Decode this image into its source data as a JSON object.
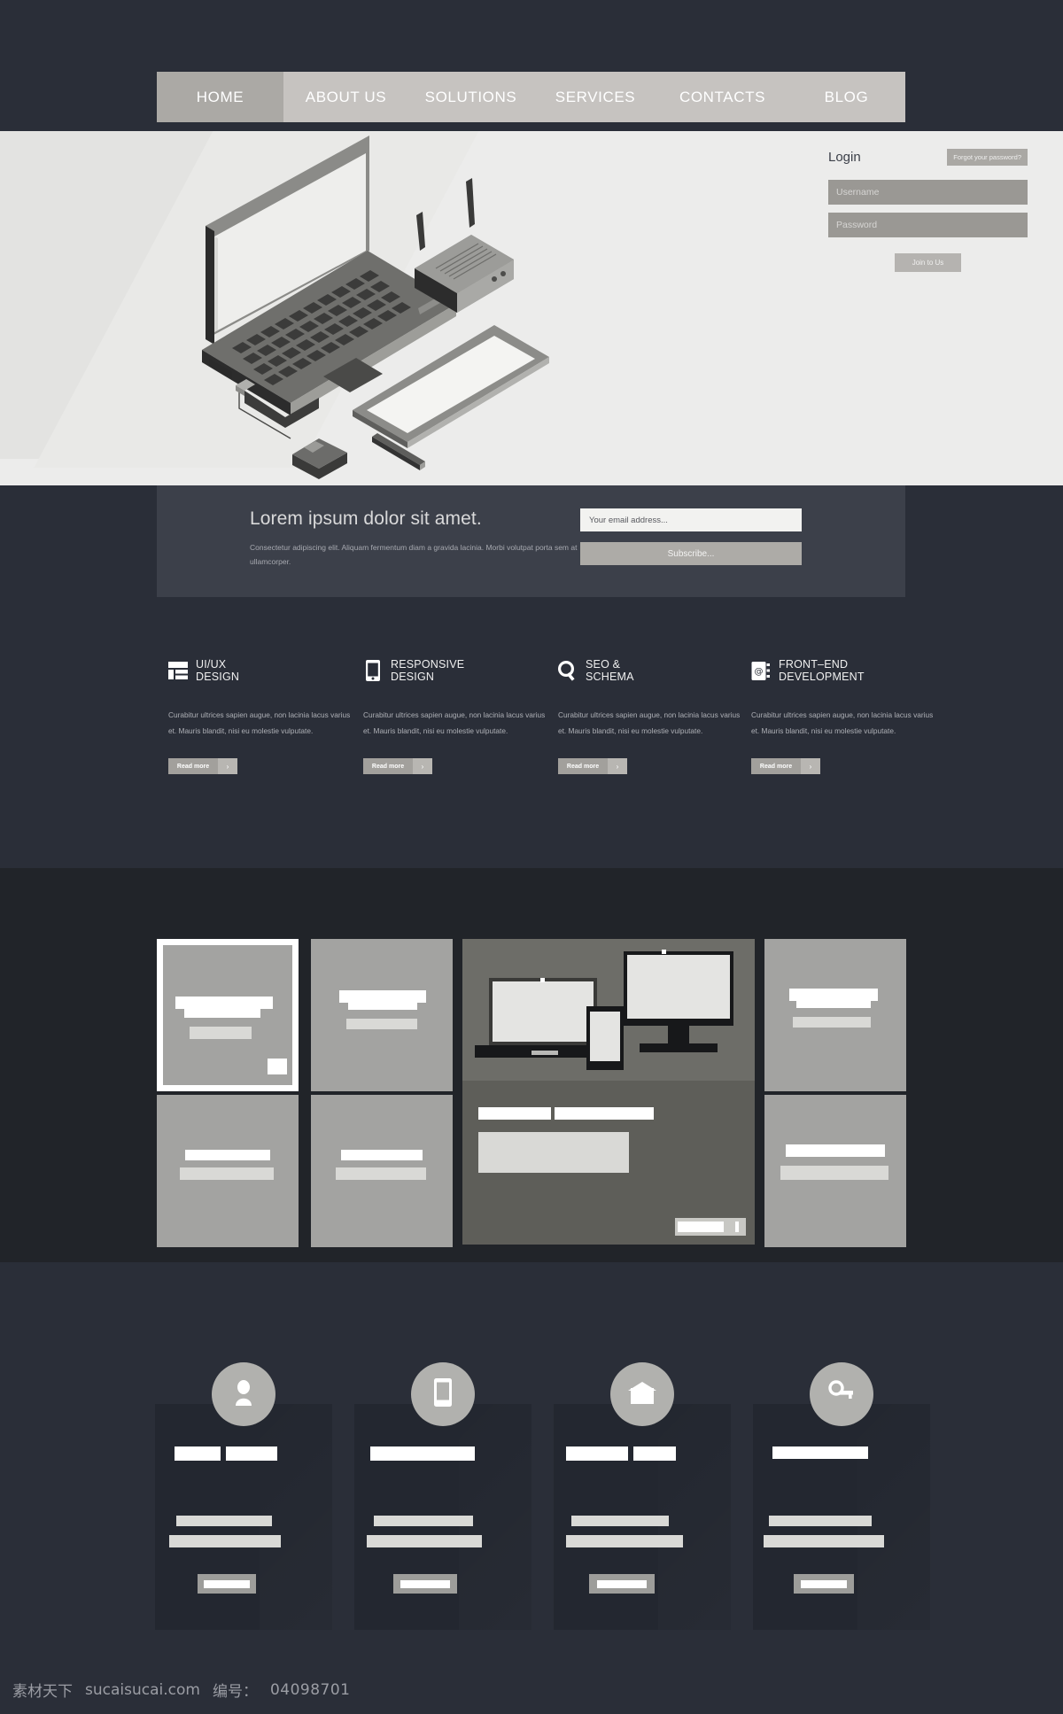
{
  "nav": {
    "items": [
      {
        "label": "HOME",
        "active": true
      },
      {
        "label": "ABOUT US",
        "active": false
      },
      {
        "label": "SOLUTIONS",
        "active": false
      },
      {
        "label": "SERVICES",
        "active": false
      },
      {
        "label": "CONTACTS",
        "active": false
      },
      {
        "label": "BLOG",
        "active": false
      }
    ]
  },
  "hero": {
    "illustration_name": "isometric-laptop-router-tablet-mouse",
    "login": {
      "title": "Login",
      "forgot_label": "Forgot your password?",
      "username_placeholder": "Username",
      "username_value": "",
      "password_placeholder": "Password",
      "password_value": "",
      "join_label": "Join to Us"
    }
  },
  "subscribe": {
    "heading": "Lorem ipsum dolor sit amet.",
    "paragraph": "Consectetur adipiscing elit. Aliquam fermentum diam a gravida lacinia. Morbi volutpat porta sem at ullamcorper.",
    "email_placeholder": "Your email address...",
    "email_value": "",
    "button_label": "Subscribe..."
  },
  "features": {
    "read_more_label": "Read more",
    "read_more_arrow": "›",
    "body_text": "Curabitur ultrices sapien augue, non lacinia lacus varius et. Mauris blandit, nisi eu molestie vulputate.",
    "items": [
      {
        "line1": "UI/UX",
        "line2": "DESIGN",
        "icon": "layout-grid-icon"
      },
      {
        "line1": "RESPONSIVE",
        "line2": "DESIGN",
        "icon": "smartphone-icon"
      },
      {
        "line1": "SEO &",
        "line2": "SCHEMA",
        "icon": "magnifier-icon"
      },
      {
        "line1": "FRONT–END",
        "line2": "DEVELOPMENT",
        "icon": "address-book-icon"
      }
    ]
  },
  "portfolio": {
    "note": "thumbnail grid of pixelated/censored project previews",
    "tiles": [
      {
        "name": "portfolio-tile-1",
        "selected": true
      },
      {
        "name": "portfolio-tile-2",
        "selected": false
      },
      {
        "name": "portfolio-tile-featured",
        "selected": false,
        "icon": "devices-desktop-laptop-phone"
      },
      {
        "name": "portfolio-tile-3",
        "selected": false
      },
      {
        "name": "portfolio-tile-4",
        "selected": false
      },
      {
        "name": "portfolio-tile-5",
        "selected": false
      },
      {
        "name": "portfolio-tile-6",
        "selected": false
      }
    ]
  },
  "cards": {
    "note": "four service cards with round icon badges; text is pixelated/censored",
    "items": [
      {
        "icon": "person-icon"
      },
      {
        "icon": "smartphone-icon"
      },
      {
        "icon": "envelope-icon"
      },
      {
        "icon": "key-icon"
      }
    ]
  },
  "watermark": {
    "site_cn": "素材天下",
    "site_url": "sucaisucai.com",
    "id_label": "编号：",
    "id_value": "04098701"
  },
  "colors": {
    "page_bg": "#2a2e38",
    "nav_bg": "#c6c3c0",
    "nav_active": "#aba9a5",
    "hero_bg": "#ececeb",
    "panel_bg": "#3c404a",
    "portfolio_bg": "#212429",
    "accent_grey": "#a2a09c",
    "tile_grey": "#a3a3a1"
  }
}
